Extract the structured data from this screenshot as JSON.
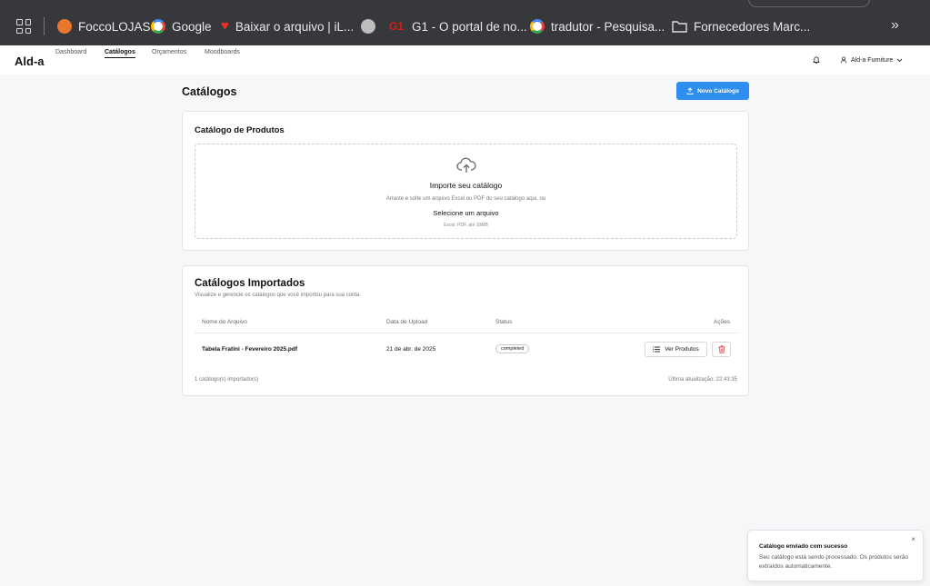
{
  "bookmarks": {
    "items": [
      {
        "label": "FoccoLOJAS",
        "icon": "focco-logo-icon",
        "color": "#e8772e"
      },
      {
        "label": "Google",
        "icon": "google-logo-icon",
        "color": "#4285f4"
      },
      {
        "label": "Baixar o arquivo | iL...",
        "icon": "ilovepdf-heart-icon",
        "color": "#e5322d"
      },
      {
        "label": "",
        "icon": "globe-icon",
        "color": "#bdbdbd"
      },
      {
        "label": "G1 - O portal de no...",
        "icon": "g1-logo-icon",
        "color": "#c4170c"
      },
      {
        "label": "tradutor - Pesquisa...",
        "icon": "google-logo-icon",
        "color": "#4285f4"
      },
      {
        "label": "Fornecedores Marc...",
        "icon": "folder-icon",
        "color": "#dddddd"
      }
    ],
    "more": "»"
  },
  "nav": {
    "logo": "Ald-a",
    "links": [
      "Dashboard",
      "Catálogos",
      "Orçamentos",
      "Moodboards"
    ],
    "active": "Catálogos",
    "user_label": "Ald-a Furniture"
  },
  "page": {
    "title": "Catálogos",
    "new_button": "Novo Catálogo",
    "accent": "#2f8ff0"
  },
  "upload": {
    "card_title": "Catálogo de Produtos",
    "title": "Importe seu catálogo",
    "subtitle": "Arraste e solte um arquivo Excel ou PDF do seu catálogo aqui, ou",
    "link": "Selecione um arquivo",
    "note": "Excel, PDF, até 10MB"
  },
  "imported": {
    "title": "Catálogos Importados",
    "subtitle": "Visualize e gerencie os catálogos que você importou para sua conta.",
    "columns": [
      "Nome do Arquivo",
      "Data de Upload",
      "Status",
      "Ações"
    ],
    "rows": [
      {
        "name": "Tabela Fratini - Fevereiro 2025.pdf",
        "date": "21 de abr. de 2025",
        "status": "completed",
        "view_label": "Ver Produtos"
      }
    ],
    "footer_count": "1 catálogo(s) importado(s)",
    "footer_updated": "Última atualização: 22:43:35"
  },
  "toast": {
    "title": "Catálogo enviado com sucesso",
    "message": "Seu catálogo está sendo processado. Os produtos serão extraídos automaticamente.",
    "close": "×"
  }
}
